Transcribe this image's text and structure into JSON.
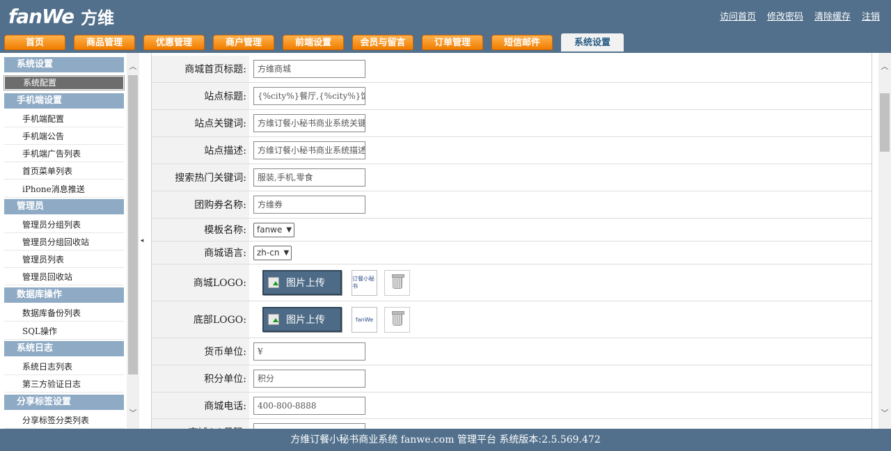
{
  "header": {
    "logo_text": "fanWe",
    "logo_cn": "方维",
    "links": [
      "访问首页",
      "修改密码",
      "清除缓存",
      "注销"
    ],
    "tabs": [
      "首页",
      "商品管理",
      "优惠管理",
      "商户管理",
      "前端设置",
      "会员与留言",
      "订单管理",
      "短信邮件",
      "系统设置"
    ],
    "active_tab": "系统设置"
  },
  "sidebar": {
    "groups": [
      {
        "title": "系统设置",
        "items": [
          "系统配置"
        ]
      },
      {
        "title": "手机端设置",
        "items": [
          "手机端配置",
          "手机端公告",
          "手机端广告列表",
          "首页菜单列表",
          "iPhone消息推送"
        ]
      },
      {
        "title": "管理员",
        "items": [
          "管理员分组列表",
          "管理员分组回收站",
          "管理员列表",
          "管理员回收站"
        ]
      },
      {
        "title": "数据库操作",
        "items": [
          "数据库备份列表",
          "SQL操作"
        ]
      },
      {
        "title": "系统日志",
        "items": [
          "系统日志列表",
          "第三方验证日志"
        ]
      },
      {
        "title": "分享标签设置",
        "items": [
          "分享标签分类列表"
        ]
      }
    ],
    "active_item": "系统配置"
  },
  "form": {
    "shop_title": {
      "label": "商城首页标题:",
      "value": "方维商城"
    },
    "site_title": {
      "label": "站点标题:",
      "value": "{%city%}餐厅,{%city%}饭店"
    },
    "site_keywords": {
      "label": "站点关键词:",
      "value": "方维订餐小秘书商业系统关键词"
    },
    "site_desc": {
      "label": "站点描述:",
      "value": "方维订餐小秘书商业系统描述"
    },
    "hot_keywords": {
      "label": "搜索热门关键词:",
      "value": "服装,手机,零食"
    },
    "coupon_name": {
      "label": "团购券名称:",
      "value": "方维券"
    },
    "template": {
      "label": "模板名称:",
      "value": "fanwe"
    },
    "language": {
      "label": "商城语言:",
      "value": "zh-cn"
    },
    "shop_logo": {
      "label": "商城LOGO:",
      "button": "图片上传",
      "thumb_text": "订餐小秘书"
    },
    "footer_logo": {
      "label": "底部LOGO:",
      "button": "图片上传",
      "thumb_text": "fanWe"
    },
    "currency": {
      "label": "货币单位:",
      "value": "¥"
    },
    "score": {
      "label": "积分单位:",
      "value": "积分"
    },
    "phone": {
      "label": "商城电话:",
      "value": "400-800-8888"
    },
    "next_label": {
      "label": "商城QQ号码:"
    }
  },
  "footer": {
    "text": "方维订餐小秘书商业系统  fanwe.com 管理平台  系统版本:2.5.569.472"
  },
  "colors": {
    "header_bg": "#52708c",
    "tab_orange": "#f07d00",
    "sidebar_group": "#8eaac5"
  }
}
